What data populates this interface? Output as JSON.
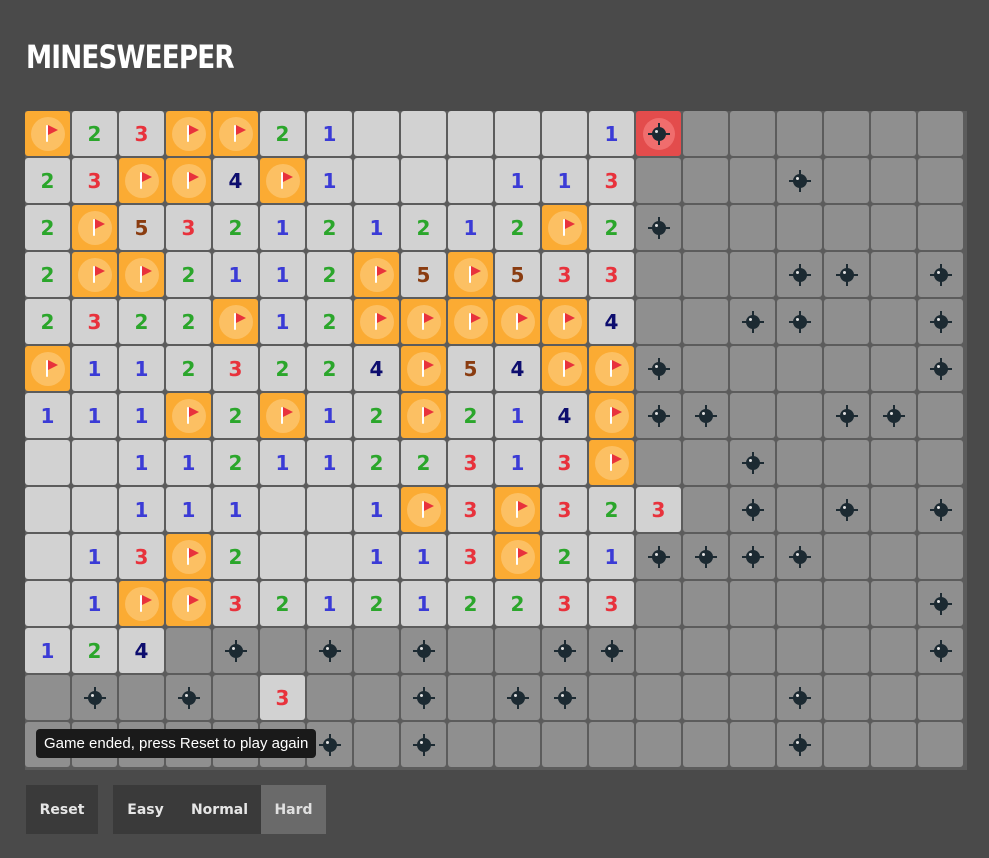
{
  "header": {
    "title": "MINESWEEPER"
  },
  "board": {
    "rows": [
      [
        "F",
        "2",
        "3",
        "F",
        "F",
        "2",
        "1",
        "0",
        "0",
        "0",
        "0",
        "0",
        "1",
        "X",
        "H",
        "H",
        "H",
        "H",
        "H",
        "H"
      ],
      [
        "2",
        "3",
        "F",
        "F",
        "4",
        "F",
        "1",
        "0",
        "0",
        "0",
        "1",
        "1",
        "3",
        "H",
        "H",
        "H",
        "M",
        "H",
        "H",
        "H"
      ],
      [
        "2",
        "F",
        "5",
        "3",
        "2",
        "1",
        "2",
        "1",
        "2",
        "1",
        "2",
        "F",
        "2",
        "M",
        "H",
        "H",
        "H",
        "H",
        "H",
        "H"
      ],
      [
        "2",
        "F",
        "F",
        "2",
        "1",
        "1",
        "2",
        "F",
        "5",
        "F",
        "5",
        "3",
        "3",
        "H",
        "H",
        "H",
        "M",
        "M",
        "H",
        "M"
      ],
      [
        "2",
        "3",
        "2",
        "2",
        "F",
        "1",
        "2",
        "F",
        "F",
        "F",
        "F",
        "F",
        "4",
        "H",
        "H",
        "M",
        "M",
        "H",
        "H",
        "M"
      ],
      [
        "F",
        "1",
        "1",
        "2",
        "3",
        "2",
        "2",
        "4",
        "F",
        "5",
        "4",
        "F",
        "F",
        "M",
        "H",
        "H",
        "H",
        "H",
        "H",
        "M"
      ],
      [
        "1",
        "1",
        "1",
        "F",
        "2",
        "F",
        "1",
        "2",
        "F",
        "2",
        "1",
        "4",
        "F",
        "M",
        "M",
        "H",
        "H",
        "M",
        "M",
        "H"
      ],
      [
        "0",
        "0",
        "1",
        "1",
        "2",
        "1",
        "1",
        "2",
        "2",
        "3",
        "1",
        "3",
        "F",
        "H",
        "H",
        "M",
        "H",
        "H",
        "H",
        "H"
      ],
      [
        "0",
        "0",
        "1",
        "1",
        "1",
        "0",
        "0",
        "1",
        "F",
        "3",
        "F",
        "3",
        "2",
        "3",
        "H",
        "M",
        "H",
        "M",
        "H",
        "M"
      ],
      [
        "0",
        "1",
        "3",
        "F",
        "2",
        "0",
        "0",
        "1",
        "1",
        "3",
        "F",
        "2",
        "1",
        "M",
        "M",
        "M",
        "M",
        "H",
        "H",
        "H"
      ],
      [
        "0",
        "1",
        "F",
        "F",
        "3",
        "2",
        "1",
        "2",
        "1",
        "2",
        "2",
        "3",
        "3",
        "H",
        "H",
        "H",
        "H",
        "H",
        "H",
        "M"
      ],
      [
        "1",
        "2",
        "4",
        "H",
        "M",
        "H",
        "M",
        "H",
        "M",
        "H",
        "H",
        "M",
        "M",
        "H",
        "H",
        "H",
        "H",
        "H",
        "H",
        "M"
      ],
      [
        "H",
        "M",
        "H",
        "M",
        "H",
        "3",
        "H",
        "H",
        "M",
        "H",
        "M",
        "M",
        "H",
        "H",
        "H",
        "H",
        "M",
        "H",
        "H",
        "H"
      ],
      [
        "H",
        "H",
        "H",
        "H",
        "H",
        "H",
        "M",
        "H",
        "M",
        "H",
        "H",
        "H",
        "H",
        "H",
        "H",
        "H",
        "M",
        "H",
        "H",
        "H"
      ]
    ]
  },
  "tooltip": {
    "text": "Game ended, press Reset to play again"
  },
  "controls": {
    "reset_label": "Reset",
    "difficulties": [
      "Easy",
      "Normal",
      "Hard"
    ],
    "selected_difficulty": "Hard"
  },
  "colors": {
    "background": "#4a4a4a",
    "revealed": "#d2d2d2",
    "hidden": "#8f8f8f",
    "flag_bg": "#fbab33",
    "exploded": "#e34c4c",
    "n1": "#3b3bd6",
    "n2": "#2ba62b",
    "n3": "#e8323c",
    "n4": "#0d0d6e",
    "n5": "#8a3c10"
  }
}
